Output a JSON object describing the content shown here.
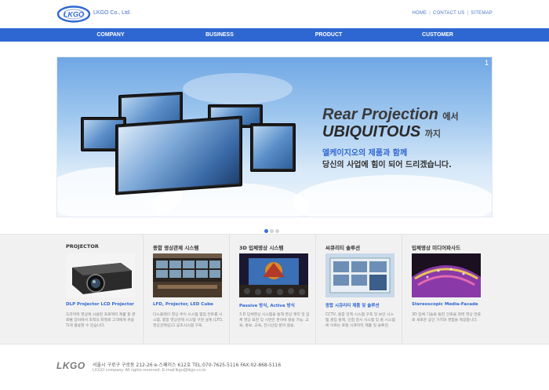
{
  "header": {
    "logo_text": "LKGO",
    "company_name": "LKGO Co., Ltd.",
    "util_links": [
      "HOME",
      "CONTACT US",
      "SITEMAP"
    ]
  },
  "gnb": {
    "items": [
      "COMPANY",
      "BUSINESS",
      "PRODUCT",
      "CUSTOMER"
    ]
  },
  "hero": {
    "slide_number": "1",
    "title_line1": "Rear Projection",
    "title_line1_suffix": "에서",
    "title_line2": "UBIQUITOUS",
    "title_line2_suffix": "까지",
    "subtitle_line1": "엘케이지오의 제품과 함께",
    "subtitle_line2": "당신의 사업에 힘이 되어 드리겠습니다.",
    "dots_total": 3,
    "dots_active": 1
  },
  "products": [
    {
      "title": "PROJECTOR",
      "subtitle": "DLP Projector LCD Projector",
      "desc": "드라마와 영상에 사용된 프로젝터 제품 등 글로벌 장비에서 최적의 화질로 고객에게 유용하게 활용할 수 있습니다."
    },
    {
      "title": "종합 영상관제 시스템",
      "subtitle": "LFD, Projector, LED Cube",
      "desc": "다스플레이 영상 주이 시스템 협업 컨트롤 시스템, 종합 영상관제 시스템 구현 설계 (LFD, 영상관제실)고 공조시스템 구축."
    },
    {
      "title": "3D 입체영상 시스템",
      "subtitle": "Passive 방식, Active 방식",
      "desc": "3 D 입체영상 시스템을 통해 영상 제작 및 입체 영상 표현 및 시연관 분야에 활용 가능. 교육, 홍보, 교육, 전시산업 분야 활용."
    },
    {
      "title": "씨큐리티 솔루션",
      "subtitle": "종합 시큐리티 제품 및 솔루션",
      "desc": "CCTV, 통합 관제 시스템 구축 및 보안 시스템 출입 통제, 인접 감시 시스템 및 홈 시스템에 이르는 토탈 시큐리티 제품 및 솔루션."
    },
    {
      "title": "입체영상 미디어파사드",
      "subtitle": "Stereoscopic Media-Facade",
      "desc": "3D 입체 기술을 통한 건축물 외벽 영상 연출로 새로운 공간 가치와 경험을 제공합니다."
    }
  ],
  "footer": {
    "logo_text": "LKGO",
    "address": "서울시 구로구 구로동 212-26 e-스페이스 612호   TEL:070-7625-5116   FAX:02-868-5116",
    "copyright": "LKGO company. All rights reserved. E-mail:lkgo@lkgo.co.kr"
  },
  "colors": {
    "brand_blue": "#2f67d2",
    "text_dark": "#333333"
  }
}
